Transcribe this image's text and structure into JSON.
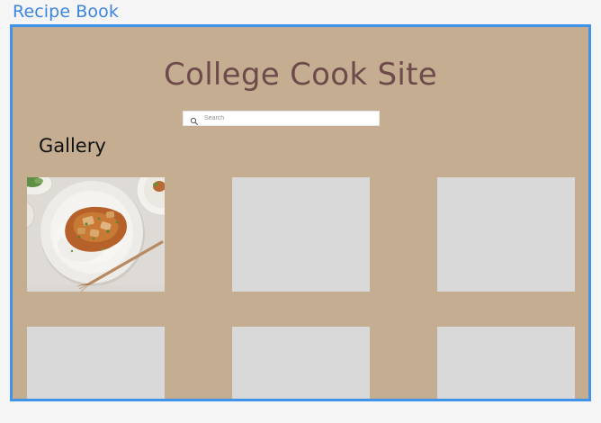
{
  "window": {
    "frame_label": "Recipe Book"
  },
  "site": {
    "title": "College Cook Site"
  },
  "search": {
    "placeholder": "Search",
    "value": "",
    "icon": "search-icon"
  },
  "gallery": {
    "heading": "Gallery",
    "items": [
      {
        "type": "photo",
        "subject": "food-photo"
      },
      {
        "type": "placeholder"
      },
      {
        "type": "placeholder"
      },
      {
        "type": "placeholder"
      },
      {
        "type": "placeholder"
      },
      {
        "type": "placeholder"
      }
    ]
  },
  "colors": {
    "frame_border": "#3f94ea",
    "page_background": "#c4ad91",
    "title_color": "#6e4a4a",
    "placeholder_tile": "#d9d9d9",
    "label_color": "#3b86e0"
  }
}
